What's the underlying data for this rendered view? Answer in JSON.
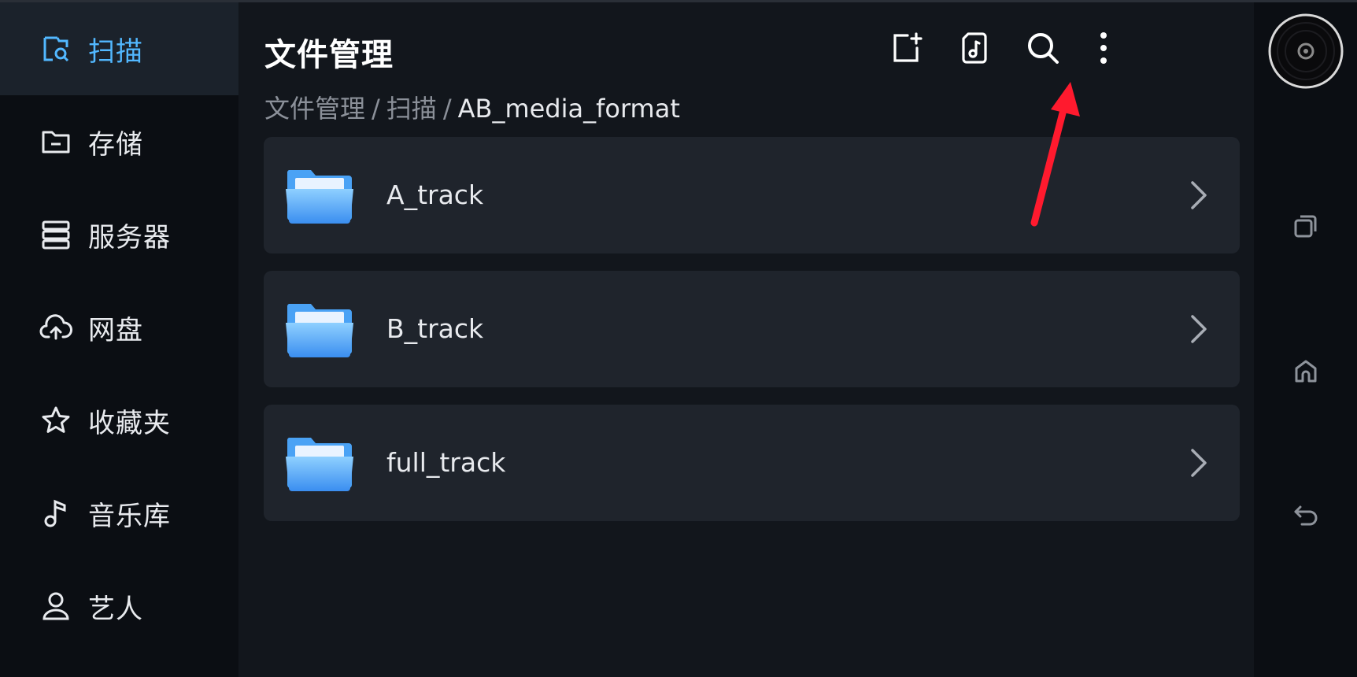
{
  "sidebar": {
    "items": [
      {
        "label": "扫描",
        "icon": "scan-folder-icon"
      },
      {
        "label": "存储",
        "icon": "folder-storage-icon"
      },
      {
        "label": "服务器",
        "icon": "server-icon"
      },
      {
        "label": "网盘",
        "icon": "cloud-upload-icon"
      },
      {
        "label": "收藏夹",
        "icon": "star-icon"
      },
      {
        "label": "音乐库",
        "icon": "music-note-icon"
      },
      {
        "label": "艺人",
        "icon": "person-icon"
      }
    ],
    "active": "扫描"
  },
  "header": {
    "title": "文件管理",
    "breadcrumb": [
      "文件管理",
      "扫描",
      "AB_media_format"
    ],
    "separator": "/",
    "toolbar": [
      "new-folder-icon",
      "music-file-icon",
      "search-icon",
      "more-vertical-icon"
    ]
  },
  "folders": [
    {
      "name": "A_track"
    },
    {
      "name": "B_track"
    },
    {
      "name": "full_track"
    }
  ],
  "system_nav": [
    "vinyl-disc-icon",
    "recent-apps-icon",
    "home-icon",
    "back-icon"
  ],
  "colors": {
    "accent": "#52b8ff",
    "annotation_arrow": "#ff1a2e",
    "row_bg": "#1f242c",
    "main_bg": "#12161c"
  }
}
